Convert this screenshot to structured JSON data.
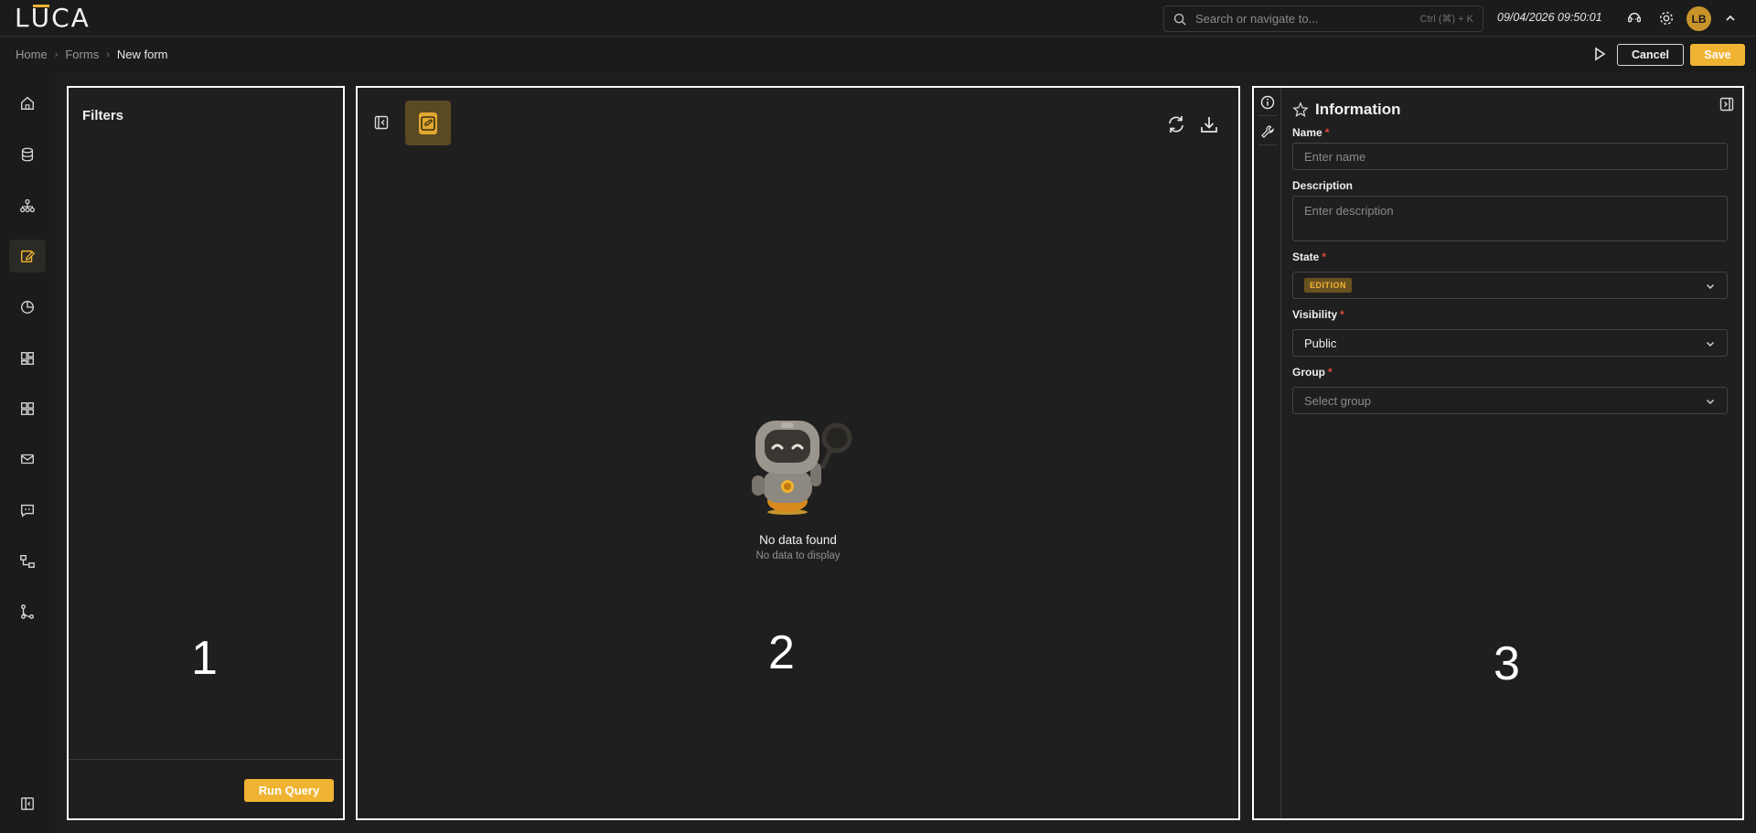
{
  "app": {
    "logo_text": "LUCA"
  },
  "topbar": {
    "search_placeholder": "Search or navigate to...",
    "search_shortcut": "Ctrl (⌘) + K",
    "datetime": "09/04/2026 09:50:01",
    "avatar_initials": "LB"
  },
  "breadcrumb": [
    "Home",
    "Forms",
    "New form"
  ],
  "actions": {
    "cancel": "Cancel",
    "save": "Save"
  },
  "leftnav": [
    {
      "icon": "home-icon"
    },
    {
      "icon": "database-icon"
    },
    {
      "icon": "hierarchy-icon"
    },
    {
      "icon": "edit-form-icon",
      "active": true
    },
    {
      "icon": "pie-chart-icon"
    },
    {
      "icon": "dashboard-icon"
    },
    {
      "icon": "grid-icon"
    },
    {
      "icon": "mail-icon"
    },
    {
      "icon": "chat-icon"
    },
    {
      "icon": "workflow-icon"
    },
    {
      "icon": "git-branch-icon"
    },
    {
      "icon": "sidebar-toggle-icon"
    }
  ],
  "panels": {
    "filters": {
      "title": "Filters",
      "run_query": "Run Query",
      "number": "1"
    },
    "preview": {
      "empty_title": "No data found",
      "empty_subtitle": "No data to display",
      "number": "2"
    },
    "information": {
      "title": "Information",
      "number": "3",
      "fields": {
        "name": {
          "label": "Name",
          "required": "*",
          "placeholder": "Enter name"
        },
        "description": {
          "label": "Description",
          "placeholder": "Enter description"
        },
        "state": {
          "label": "State",
          "required": "*",
          "value": "EDITION"
        },
        "visibility": {
          "label": "Visibility",
          "required": "*",
          "value": "Public"
        },
        "group": {
          "label": "Group",
          "required": "*",
          "placeholder": "Select group"
        }
      }
    }
  },
  "colors": {
    "accent": "#f0b432",
    "background": "#1e1e1e",
    "required": "#e04a3a"
  }
}
